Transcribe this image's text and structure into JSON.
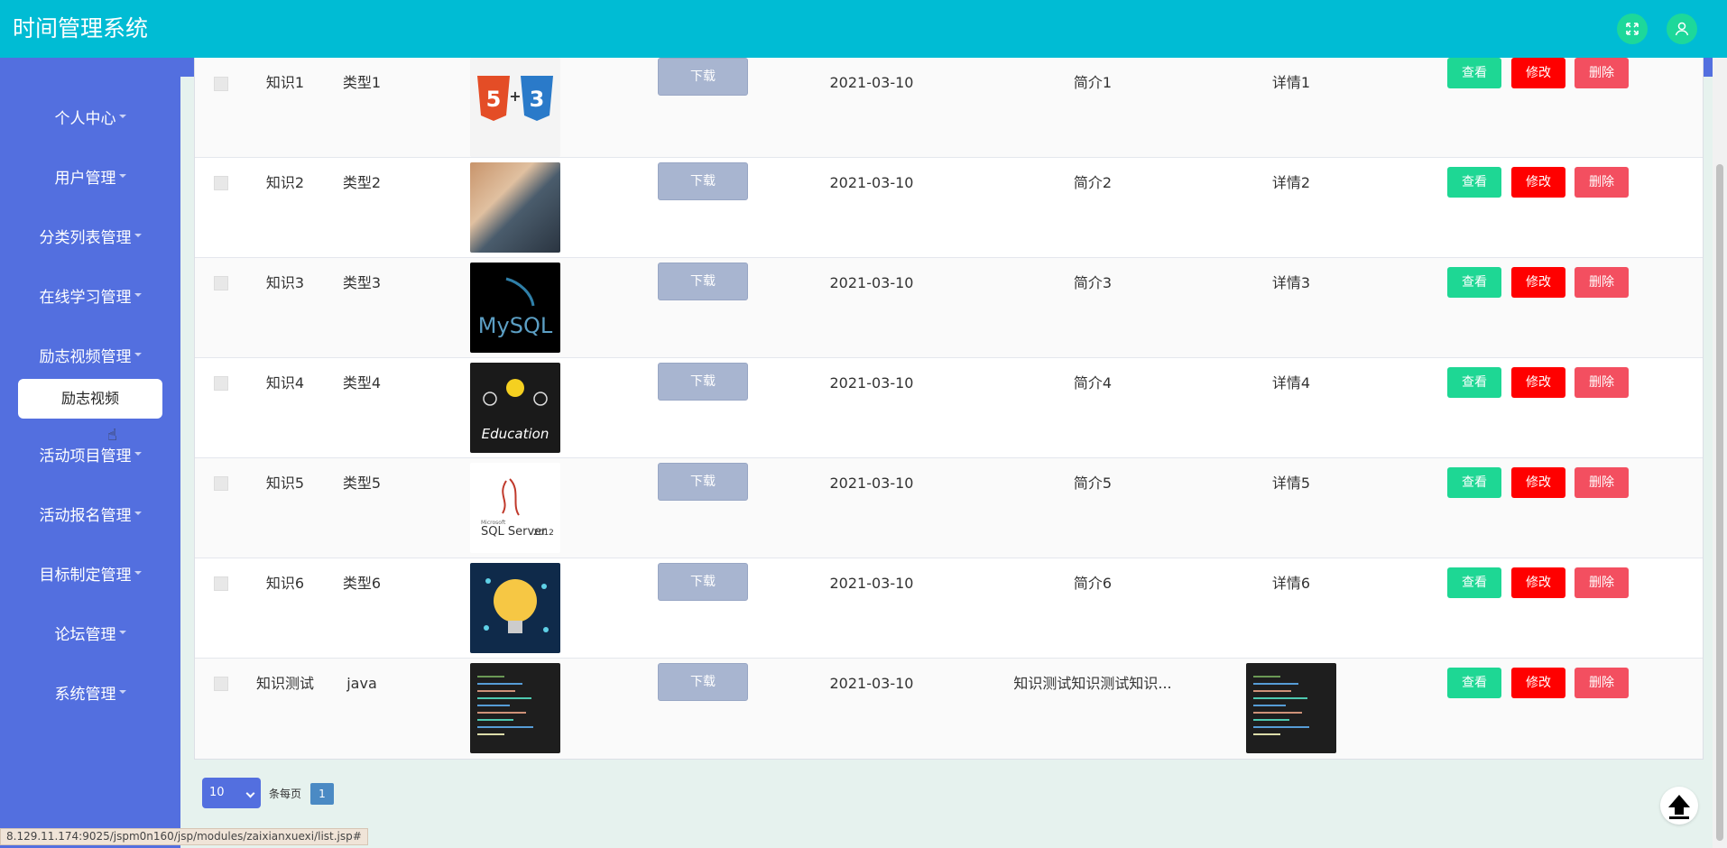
{
  "header": {
    "title": "时间管理系统"
  },
  "sidebar": {
    "items": [
      {
        "label": "个人中心"
      },
      {
        "label": "用户管理"
      },
      {
        "label": "分类列表管理"
      },
      {
        "label": "在线学习管理"
      },
      {
        "label": "励志视频管理"
      },
      {
        "label": "活动项目管理"
      },
      {
        "label": "活动报名管理"
      },
      {
        "label": "目标制定管理"
      },
      {
        "label": "论坛管理"
      },
      {
        "label": "系统管理"
      }
    ],
    "submenu_active": "励志视频"
  },
  "table": {
    "download_label": "下载",
    "view_label": "查看",
    "edit_label": "修改",
    "delete_label": "删除",
    "rows": [
      {
        "name": "知识1",
        "type": "类型1",
        "date": "2021-03-10",
        "intro": "简介1",
        "detail": "详情1",
        "image": "html5-css3-logo"
      },
      {
        "name": "知识2",
        "type": "类型2",
        "date": "2021-03-10",
        "intro": "简介2",
        "detail": "详情2",
        "image": "laptop-photo"
      },
      {
        "name": "知识3",
        "type": "类型3",
        "date": "2021-03-10",
        "intro": "简介3",
        "detail": "详情3",
        "image": "mysql-logo"
      },
      {
        "name": "知识4",
        "type": "类型4",
        "date": "2021-03-10",
        "intro": "简介4",
        "detail": "详情4",
        "image": "education-chalkboard"
      },
      {
        "name": "知识5",
        "type": "类型5",
        "date": "2021-03-10",
        "intro": "简介5",
        "detail": "详情5",
        "image": "sqlserver-logo"
      },
      {
        "name": "知识6",
        "type": "类型6",
        "date": "2021-03-10",
        "intro": "简介6",
        "detail": "详情6",
        "image": "lightbulb-illustration"
      },
      {
        "name": "知识测试",
        "type": "java",
        "date": "2021-03-10",
        "intro": "知识测试知识测试知识...",
        "detail": "",
        "image": "code-screenshot"
      }
    ]
  },
  "pagination": {
    "page_size": "10",
    "per_page_label": "条每页",
    "current_page": "1"
  },
  "status_bar": {
    "url": "8.129.11.174:9025/jspm0n160/jsp/modules/zaixianxuexi/list.jsp#"
  },
  "sqlserver_text": {
    "brand": "SQL Server",
    "version": "2012",
    "small": "Microsoft"
  },
  "mysql_text": "MySQL",
  "education_text": "Education",
  "colors": {
    "header": "#00bcd4",
    "sidebar": "#536fdf",
    "view": "#1ed794",
    "edit": "#ff0000",
    "delete": "#f34f60"
  }
}
